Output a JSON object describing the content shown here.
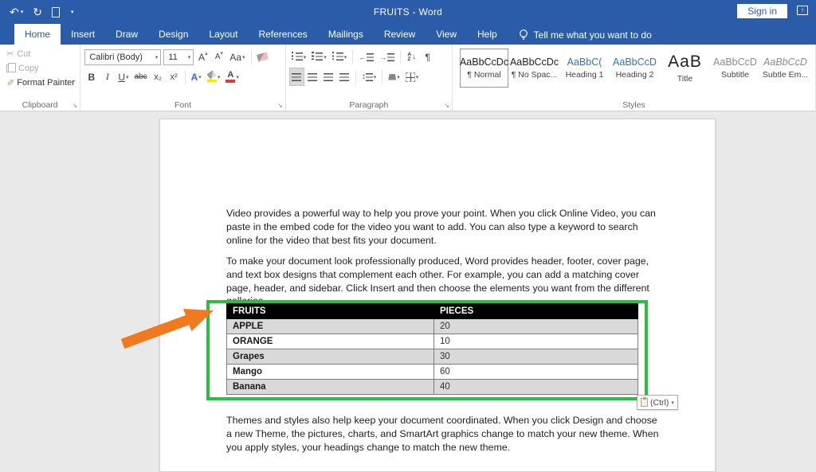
{
  "titlebar": {
    "title": "FRUITS  -  Word",
    "sign_in_label": "Sign in"
  },
  "icons": {
    "undo": "↶",
    "redo": "↻",
    "dropdown": "▾",
    "pilcrow": "¶",
    "scissors": "✂",
    "format_painter": "✎",
    "grow_font": "A",
    "shrink_font": "A",
    "change_case": "Aa",
    "bold": "B",
    "italic": "I",
    "underline": "U",
    "strikethrough": "abc",
    "subscript": "x₂",
    "superscript": "x²",
    "text_effects": "A",
    "font_color": "A",
    "updown": "↕",
    "sort_a": "A",
    "sort_z": "Z",
    "sort_arrow": "↓",
    "outdent_arrow": "←",
    "indent_arrow": "→",
    "ribbon_display": "↑",
    "launcher": "↘"
  },
  "tabs": [
    {
      "label": "Home",
      "active": true
    },
    {
      "label": "Insert"
    },
    {
      "label": "Draw"
    },
    {
      "label": "Design"
    },
    {
      "label": "Layout"
    },
    {
      "label": "References"
    },
    {
      "label": "Mailings"
    },
    {
      "label": "Review"
    },
    {
      "label": "View"
    },
    {
      "label": "Help"
    }
  ],
  "tell_me": {
    "label": "Tell me what you want to do"
  },
  "ribbon": {
    "clipboard": {
      "label": "Clipboard",
      "cut": "Cut",
      "copy": "Copy",
      "format_painter": "Format Painter"
    },
    "font": {
      "label": "Font",
      "font_name": "Calibri (Body)",
      "font_size": "11"
    },
    "paragraph": {
      "label": "Paragraph"
    },
    "styles": {
      "label": "Styles",
      "items": [
        {
          "preview": "AaBbCcDc",
          "name": "¶ Normal"
        },
        {
          "preview": "AaBbCcDc",
          "name": "¶ No Spac..."
        },
        {
          "preview": "AaBbC(",
          "name": "Heading 1"
        },
        {
          "preview": "AaBbCcD",
          "name": "Heading 2"
        },
        {
          "preview": "AaB",
          "name": "Title"
        },
        {
          "preview": "AaBbCcD",
          "name": "Subtitle"
        },
        {
          "preview": "AaBbCcD",
          "name": "Subtle Em..."
        }
      ]
    }
  },
  "document": {
    "paragraphs": [
      "Video provides a powerful way to help you prove your point. When you click Online Video, you can paste in the embed code for the video you want to add. You can also type a keyword to search online for the video that best fits your document.",
      "To make your document look professionally produced, Word provides header, footer, cover page, and text box designs that complement each other. For example, you can add a matching cover page, header, and sidebar. Click Insert and then choose the elements you want from the different galleries.",
      "Themes and styles also help keep your document coordinated. When you click Design and choose a new Theme, the pictures, charts, and SmartArt graphics change to match your new theme. When you apply styles, your headings change to match the new theme."
    ],
    "table": {
      "headers": [
        "FRUITS",
        "PIECES"
      ],
      "rows": [
        [
          "APPLE",
          "20"
        ],
        [
          "ORANGE",
          "10"
        ],
        [
          "Grapes",
          "30"
        ],
        [
          "Mango",
          "60"
        ],
        [
          "Banana",
          "40"
        ]
      ]
    },
    "paste_button": {
      "label": "(Ctrl)"
    }
  },
  "colors": {
    "titlebar_blue": "#2a5caa",
    "annotation_green": "#27c13e",
    "arrow_orange": "#f07a20",
    "table_header_bg": "#000000",
    "table_alt_row": "#d9d9d9"
  }
}
